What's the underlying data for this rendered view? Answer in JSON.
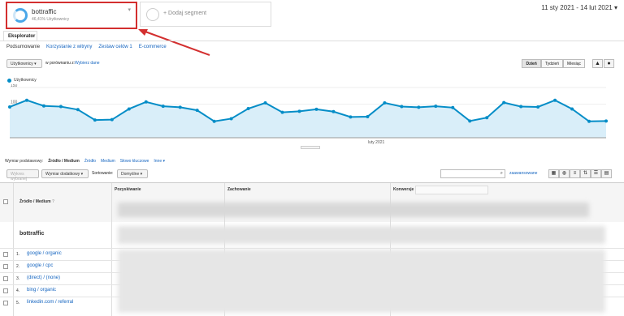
{
  "segments": {
    "active": {
      "name": "bottraffic",
      "subtitle": "46,41% Użytkownicy"
    },
    "add_label": "+ Dodaj segment"
  },
  "date_range": "11 sty 2021 - 14 lut 2021",
  "tabs": {
    "explorer": "Eksplorator"
  },
  "subtabs": [
    "Podsumowanie",
    "Korzystanie z witryny",
    "Zestaw celów 1",
    "E-commerce"
  ],
  "controls": {
    "metric_select": "Użytkownicy",
    "compare_label": "w porównaniu z:",
    "compare_link": "Wybierz dane",
    "granularity": [
      "Dzień",
      "Tydzień",
      "Miesiąc"
    ],
    "active_granularity": "Dzień"
  },
  "chart_data": {
    "type": "line",
    "series": [
      {
        "name": "Użytkownicy",
        "values": [
          92,
          112,
          95,
          93,
          84,
          53,
          54,
          86,
          107,
          94,
          91,
          82,
          49,
          57,
          87,
          104,
          76,
          79,
          85,
          78,
          62,
          63,
          104,
          93,
          91,
          94,
          90,
          50,
          60,
          105,
          93,
          92,
          112,
          86,
          49,
          50
        ]
      }
    ],
    "x_label": "luty 2021",
    "y_ticks": [
      150,
      100,
      50
    ],
    "ylim": [
      0,
      150
    ],
    "color": "#058dc7",
    "fill": "#d9eef9"
  },
  "dimensions": {
    "label": "Wymiar podstawowy:",
    "selected": "Źródło / Medium",
    "options": [
      "Źródło",
      "Medium",
      "Słowo kluczowe",
      "Inne"
    ]
  },
  "table_controls": {
    "plot_rows": "Wykres wybranej",
    "secondary_dim": "Wymiar dodatkowy",
    "sort_label": "Sortowanie:",
    "sort_value": "Domyślne",
    "advanced": "zaawansowane"
  },
  "table": {
    "col_headers": {
      "source": "Źródło / Medium",
      "acq": "Pozyskiwanie",
      "beh": "Zachowanie",
      "conv": "Konwersje"
    },
    "segment_label": "bottraffic",
    "rows": [
      {
        "num": "1.",
        "label": "google / organic"
      },
      {
        "num": "2.",
        "label": "google / cpc"
      },
      {
        "num": "3.",
        "label": "(direct) / (none)"
      },
      {
        "num": "4.",
        "label": "bing / organic"
      },
      {
        "num": "5.",
        "label": "linkedin.com / referral"
      }
    ]
  }
}
